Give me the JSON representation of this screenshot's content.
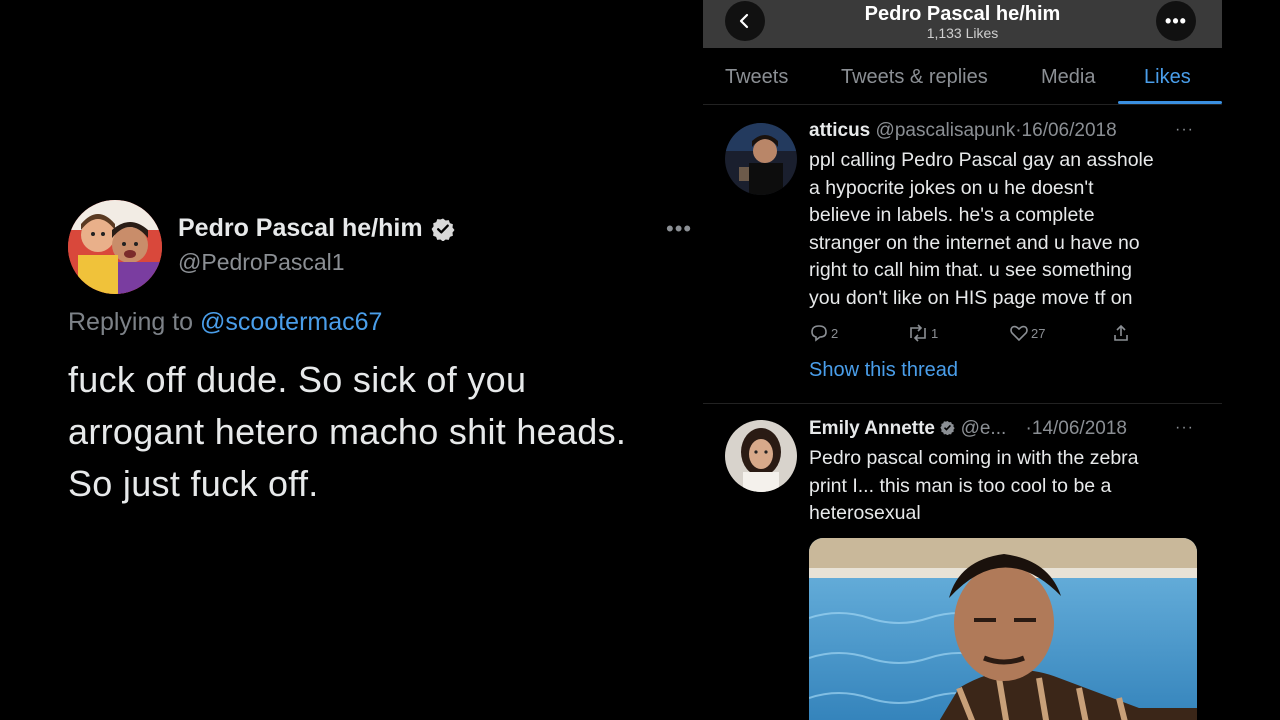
{
  "left_tweet": {
    "author_name": "Pedro Pascal he/him",
    "author_handle": "@PedroPascal1",
    "more_icon": "•••",
    "replying_prefix": "Replying to ",
    "replying_mention": "@scootermac67",
    "body_lines": [
      "fuck off dude. So sick of you",
      "arrogant hetero macho shit heads.",
      "So just fuck off."
    ]
  },
  "phone": {
    "header": {
      "back_icon": "chevron-left-icon",
      "title": "Pedro Pascal he/him",
      "subtitle": "1,133 Likes",
      "more_icon": "•••"
    },
    "tabs": [
      "Tweets",
      "Tweets & replies",
      "Media",
      "Likes"
    ],
    "active_tab": "Likes",
    "items": [
      {
        "name": "atticus",
        "handle": "@pascalisapunk",
        "date": "·16/06/2018",
        "more": "···",
        "text_lines": [
          "ppl calling Pedro Pascal gay an asshole",
          "a hypocrite jokes on u he doesn't",
          "believe in labels. he's a complete",
          "stranger on the internet and u have no",
          "right to call him that. u see something",
          "you don't like on HIS page move tf on"
        ],
        "replies": "2",
        "retweets": "1",
        "likes": "27",
        "show_thread": "Show this thread"
      },
      {
        "name": "Emily Annette",
        "handle": "@e...",
        "date": "·14/06/2018",
        "more": "···",
        "text_lines": [
          "Pedro pascal coming in with the zebra",
          "print I... this man is too cool to be a",
          "heterosexual"
        ]
      }
    ]
  },
  "colors": {
    "background": "#000000",
    "accent": "#4a9eea",
    "muted": "#8b8f94",
    "text": "#e7e9ea"
  }
}
